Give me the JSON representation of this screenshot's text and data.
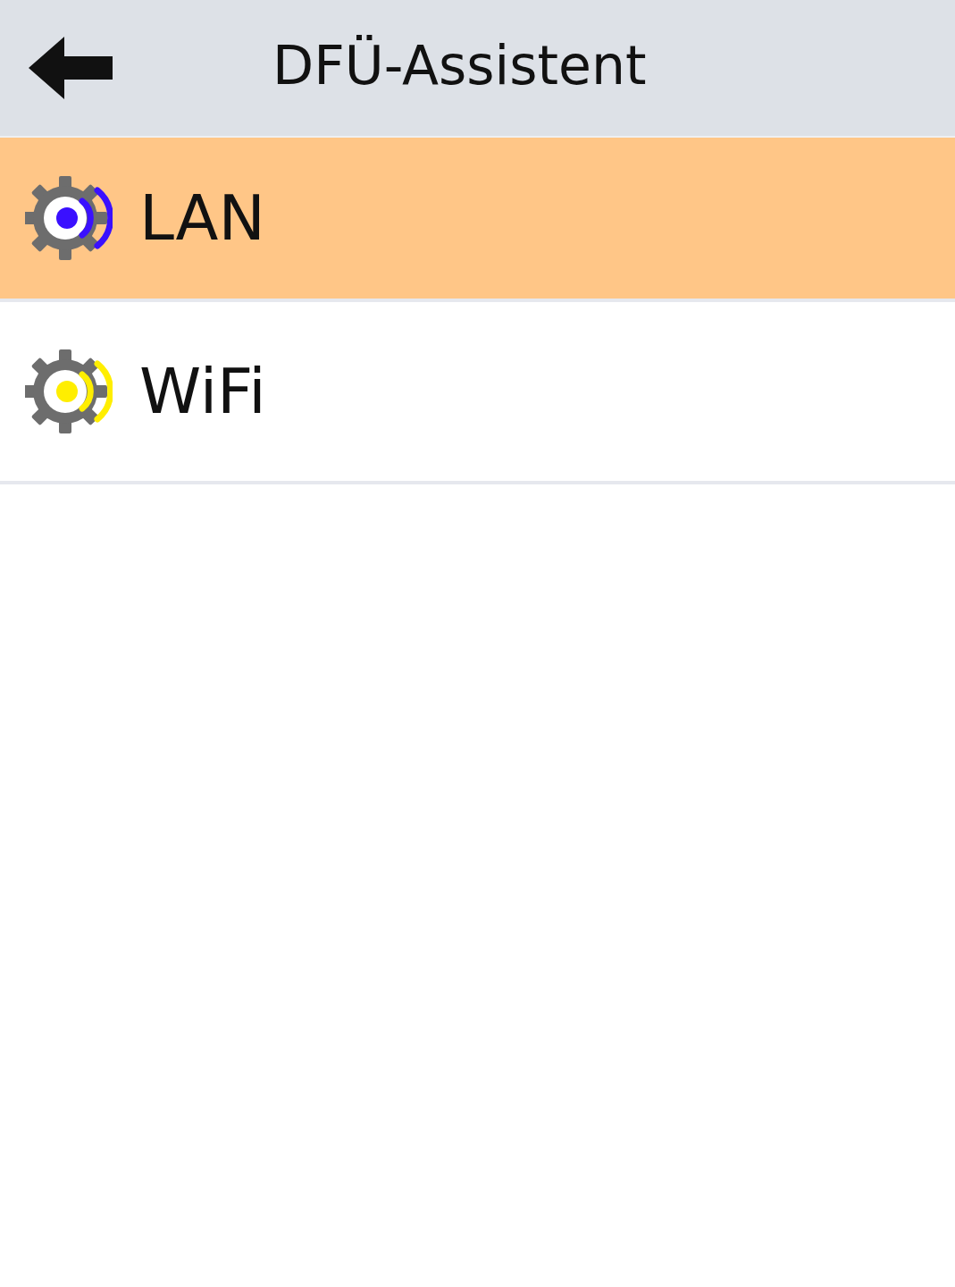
{
  "header": {
    "title": "DFÜ-Assistent"
  },
  "items": [
    {
      "label": "LAN",
      "selected": true,
      "color": "#3a10ff"
    },
    {
      "label": "WiFi",
      "selected": false,
      "color": "#ffee00"
    }
  ]
}
